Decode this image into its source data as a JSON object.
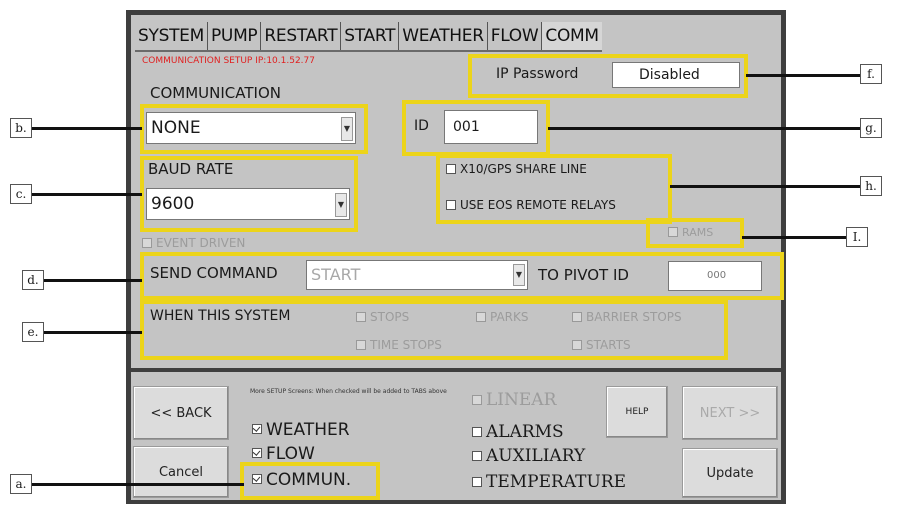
{
  "tabs": [
    "SYSTEM",
    "PUMP",
    "RESTART",
    "START",
    "WEATHER",
    "FLOW",
    "COMM"
  ],
  "header": {
    "setup_line": "COMMUNICATION SETUP IP:10.1.52.77"
  },
  "communication": {
    "label": "COMMUNICATION",
    "value": "NONE"
  },
  "baud": {
    "label": "BAUD RATE",
    "value": "9600"
  },
  "ip_password": {
    "label": "IP Password",
    "value": "Disabled"
  },
  "id_field": {
    "label": "ID",
    "value": "001"
  },
  "checkboxes_h": {
    "x10": "X10/GPS SHARE LINE",
    "eos": "USE EOS REMOTE RELAYS"
  },
  "event_driven": "EVENT DRIVEN",
  "rams": "RAMS",
  "send_command": {
    "label": "SEND COMMAND",
    "value": "START",
    "to_label": "TO PIVOT ID",
    "pivot_value": "000"
  },
  "when_system": {
    "label": "WHEN THIS SYSTEM",
    "stops": "STOPS",
    "parks": "PARKS",
    "barrier_stops": "BARRIER STOPS",
    "time_stops": "TIME STOPS",
    "starts": "STARTS"
  },
  "bottom": {
    "back": "<< BACK",
    "cancel": "Cancel",
    "note": "More SETUP Screens: When checked will be added to TABS above",
    "weather": "WEATHER",
    "flow": "FLOW",
    "commun": "COMMUN.",
    "linear": "LINEAR",
    "alarms": "ALARMS",
    "auxiliary": "AUXILIARY",
    "temperature": "TEMPERATURE",
    "help": "HELP",
    "next": "NEXT >>",
    "update": "Update"
  },
  "callouts": {
    "a": "a.",
    "b": "b.",
    "c": "c.",
    "d": "d.",
    "e": "e.",
    "f": "f.",
    "g": "g.",
    "h": "h.",
    "i": "I."
  }
}
